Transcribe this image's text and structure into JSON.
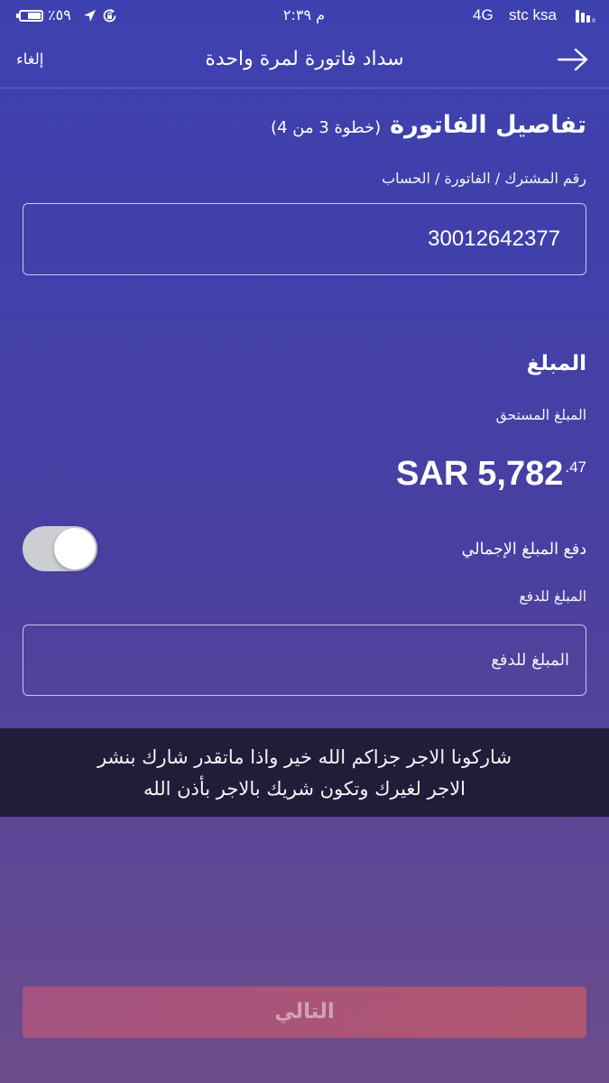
{
  "status_bar": {
    "battery_percent": "٥٩٪",
    "battery_level": 0.59,
    "time": "٢:٣٩ م",
    "network": "4G",
    "carrier": "stc ksa",
    "signal_bars": 3
  },
  "header": {
    "cancel_label": "إلغاء",
    "title": "سداد فاتورة لمرة واحدة"
  },
  "bill_details": {
    "title": "تفاصيل الفاتورة",
    "step": "(خطوة 3 من 4)",
    "account_label": "رقم المشترك / الفاتورة / الحساب",
    "account_value": "30012642377"
  },
  "amount": {
    "section_title": "المبلغ",
    "due_label": "المبلغ المستحق",
    "due_currency": "SAR",
    "due_whole": "5,782",
    "due_fraction": ".47",
    "pay_full_label": "دفع المبلغ الإجمالي",
    "pay_full_enabled": false,
    "pay_amount_label": "المبلغ للدفع",
    "pay_amount_placeholder": "المبلغ للدفع"
  },
  "overlay_caption": {
    "lines": [
      "شاركونا الاجر جزاكم الله خير واذا ماتقدر شارك بنشر",
      "الاجر لغيرك وتكون شريك بالاجر بأذن الله"
    ]
  },
  "footer": {
    "next_label": "التالي",
    "next_enabled": false
  },
  "icons": {
    "back": "arrow-right-icon",
    "battery": "battery-icon",
    "location": "location-arrow-icon",
    "rotation_lock": "rotation-lock-icon",
    "signal": "signal-bars-icon"
  },
  "colors": {
    "bg_top": "#3d41af",
    "bg_bottom": "#6c4d8b",
    "field_border": "#c8c6ea",
    "toggle_track": "#cdcdd4",
    "caption_bg": "#1e1b34",
    "next_left": "#d65876",
    "next_right": "#ec6056"
  }
}
